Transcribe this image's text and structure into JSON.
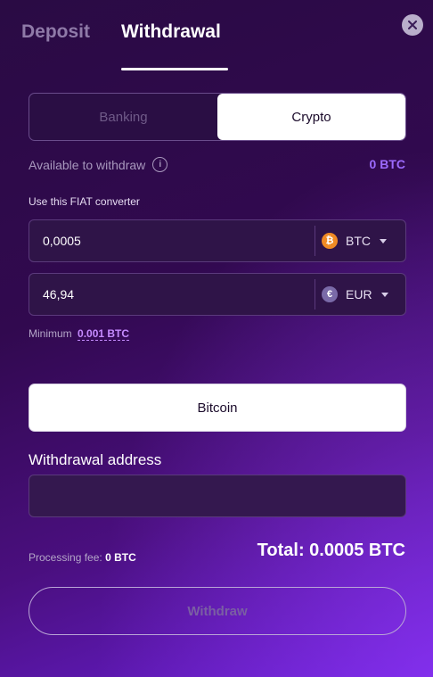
{
  "tabs": {
    "deposit": "Deposit",
    "withdrawal": "Withdrawal",
    "active": "withdrawal"
  },
  "segment": {
    "banking": "Banking",
    "crypto": "Crypto",
    "active": "crypto"
  },
  "available": {
    "label": "Available to withdraw",
    "value": "0 BTC",
    "info_icon": "i"
  },
  "converter": {
    "label": "Use this FIAT converter",
    "crypto_amount": "0,0005",
    "crypto_currency": "BTC",
    "crypto_icon": "₿",
    "fiat_amount": "46,94",
    "fiat_currency": "EUR",
    "fiat_icon": "€"
  },
  "minimum": {
    "label": "Minimum",
    "value": "0.001 BTC"
  },
  "method": {
    "label": "Bitcoin"
  },
  "address": {
    "label": "Withdrawal address",
    "value": ""
  },
  "fee": {
    "label": "Processing fee:",
    "value": "0 BTC"
  },
  "total": {
    "label": "Total: 0.0005 BTC"
  },
  "withdraw_button": {
    "label": "Withdraw"
  },
  "colors": {
    "background_top": "#2a0b44",
    "background_bottom": "#6a1fd6",
    "accent": "#9d6bff",
    "btc_coin": "#f08a24",
    "eur_coin": "#7a6aa8"
  }
}
